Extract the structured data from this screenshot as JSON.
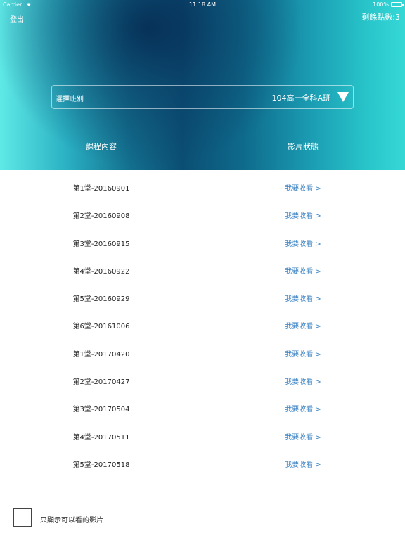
{
  "status_bar": {
    "carrier": "Carrier",
    "time": "11:18 AM",
    "battery": "100%"
  },
  "header": {
    "logout_label": "登出",
    "points_label": "剩餘點數:3",
    "selector": {
      "label": "選擇班別",
      "value": "104高一全科A班"
    },
    "columns": {
      "course": "課程內容",
      "status": "影片狀態"
    }
  },
  "courses": [
    {
      "title": "第1堂-20160901",
      "action": "我要收看 >"
    },
    {
      "title": "第2堂-20160908",
      "action": "我要收看 >"
    },
    {
      "title": "第3堂-20160915",
      "action": "我要收看 >"
    },
    {
      "title": "第4堂-20160922",
      "action": "我要收看 >"
    },
    {
      "title": "第5堂-20160929",
      "action": "我要收看 >"
    },
    {
      "title": "第6堂-20161006",
      "action": "我要收看 >"
    },
    {
      "title": "第1堂-20170420",
      "action": "我要收看 >"
    },
    {
      "title": "第2堂-20170427",
      "action": "我要收看 >"
    },
    {
      "title": "第3堂-20170504",
      "action": "我要收看 >"
    },
    {
      "title": "第4堂-20170511",
      "action": "我要收看 >"
    },
    {
      "title": "第5堂-20170518",
      "action": "我要收看 >"
    }
  ],
  "filter": {
    "label": "只顯示可以看的影片",
    "checked": false
  },
  "colors": {
    "link": "#3a82c4",
    "header_dark": "#0b4e74",
    "header_light": "#5fe9e6"
  }
}
